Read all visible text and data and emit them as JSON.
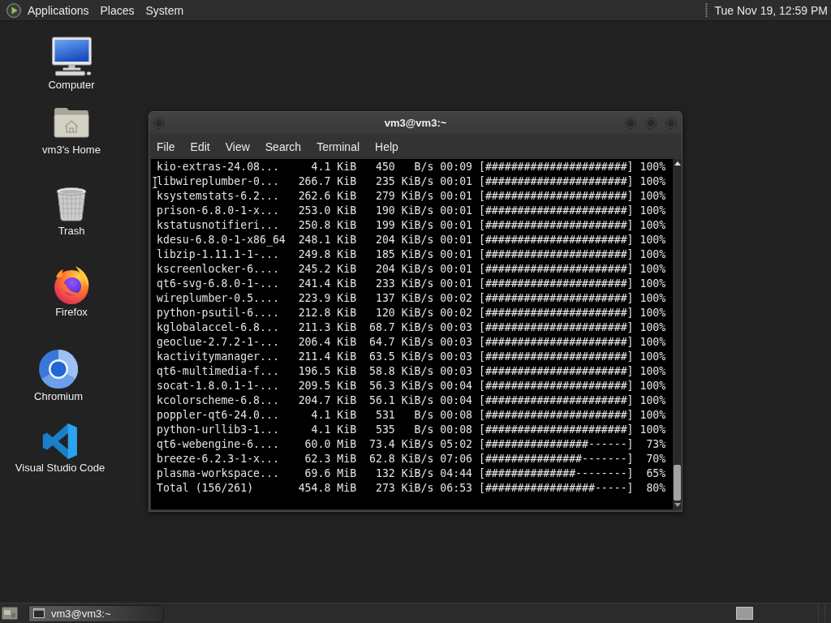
{
  "top_panel": {
    "menus": [
      "Applications",
      "Places",
      "System"
    ],
    "clock": "Tue Nov 19, 12:59 PM"
  },
  "desktop_icons": [
    {
      "kind": "computer",
      "label": "Computer"
    },
    {
      "kind": "home-folder",
      "label": "vm3's Home"
    },
    {
      "kind": "trash",
      "label": "Trash"
    },
    {
      "kind": "firefox",
      "label": "Firefox"
    },
    {
      "kind": "chromium",
      "label": "Chromium"
    },
    {
      "kind": "vscode",
      "label": "Visual Studio Code"
    }
  ],
  "terminal_window": {
    "title": "vm3@vm3:~",
    "menus": [
      "File",
      "Edit",
      "View",
      "Search",
      "Terminal",
      "Help"
    ],
    "lines": [
      "kio-extras-24.08...     4.1 KiB   450   B/s 00:09 [######################] 100%",
      "libwireplumber-0...   266.7 KiB   235 KiB/s 00:01 [######################] 100%",
      "ksystemstats-6.2...   262.6 KiB   279 KiB/s 00:01 [######################] 100%",
      "prison-6.8.0-1-x...   253.0 KiB   190 KiB/s 00:01 [######################] 100%",
      "kstatusnotifieri...   250.8 KiB   199 KiB/s 00:01 [######################] 100%",
      "kdesu-6.8.0-1-x86_64  248.1 KiB   204 KiB/s 00:01 [######################] 100%",
      "libzip-1.11.1-1-...   249.8 KiB   185 KiB/s 00:01 [######################] 100%",
      "kscreenlocker-6....   245.2 KiB   204 KiB/s 00:01 [######################] 100%",
      "qt6-svg-6.8.0-1-...   241.4 KiB   233 KiB/s 00:01 [######################] 100%",
      "wireplumber-0.5....   223.9 KiB   137 KiB/s 00:02 [######################] 100%",
      "python-psutil-6....   212.8 KiB   120 KiB/s 00:02 [######################] 100%",
      "kglobalaccel-6.8...   211.3 KiB  68.7 KiB/s 00:03 [######################] 100%",
      "geoclue-2.7.2-1-...   206.4 KiB  64.7 KiB/s 00:03 [######################] 100%",
      "kactivitymanager...   211.4 KiB  63.5 KiB/s 00:03 [######################] 100%",
      "qt6-multimedia-f...   196.5 KiB  58.8 KiB/s 00:03 [######################] 100%",
      "socat-1.8.0.1-1-...   209.5 KiB  56.3 KiB/s 00:04 [######################] 100%",
      "kcolorscheme-6.8...   204.7 KiB  56.1 KiB/s 00:04 [######################] 100%",
      "poppler-qt6-24.0...     4.1 KiB   531   B/s 00:08 [######################] 100%",
      "python-urllib3-1...     4.1 KiB   535   B/s 00:08 [######################] 100%",
      "qt6-webengine-6....    60.0 MiB  73.4 KiB/s 05:02 [################------]  73%",
      "breeze-6.2.3-1-x...    62.3 MiB  62.8 KiB/s 07:06 [###############-------]  70%",
      "plasma-workspace...    69.6 MiB   132 KiB/s 04:44 [##############--------]  65%",
      "Total (156/261)       454.8 MiB   273 KiB/s 06:53 [#################-----]  80%"
    ]
  },
  "taskbar": {
    "tasks": [
      {
        "label": "vm3@vm3:~"
      }
    ]
  }
}
